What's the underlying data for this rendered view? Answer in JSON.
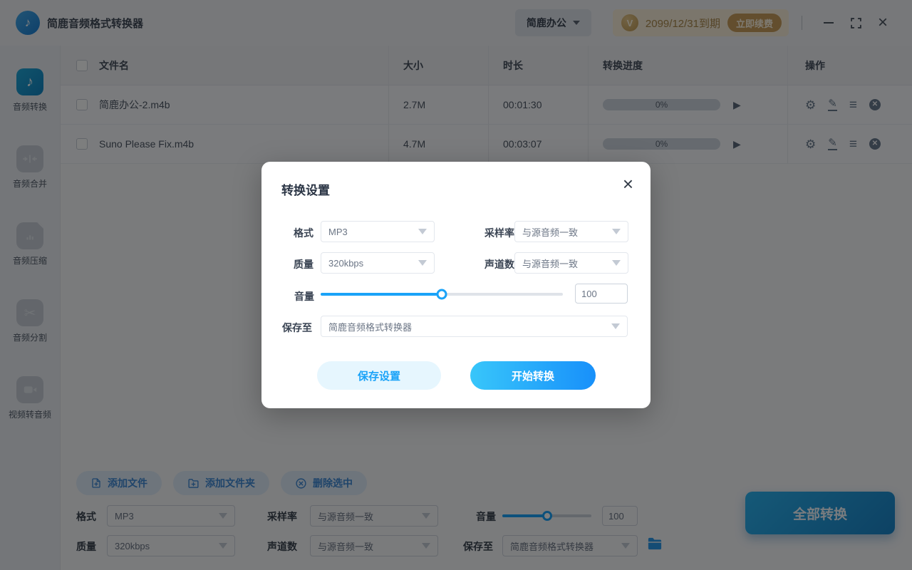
{
  "header": {
    "app_title": "简鹿音频格式转换器",
    "workspace_label": "简鹿办公",
    "license": {
      "vip_glyph": "V",
      "expiry_text": "2099/12/31到期",
      "renew_label": "立即续费"
    }
  },
  "icons": {
    "logo_note": "♪",
    "play": "▶",
    "gear": "⚙",
    "edit": "✎",
    "menu": "≡",
    "row_remove": "✕",
    "close": "×",
    "scissors": "✂",
    "music_note": "♪"
  },
  "sidebar": {
    "items": [
      {
        "label": "音频转换",
        "icon": "music-note",
        "active": true
      },
      {
        "label": "音频合并",
        "icon": "merge-arrows"
      },
      {
        "label": "音频压缩",
        "icon": "compress-file"
      },
      {
        "label": "音频分割",
        "icon": "scissors"
      },
      {
        "label": "视频转音频",
        "icon": "video-camera"
      }
    ]
  },
  "table": {
    "headers": [
      "文件名",
      "大小",
      "时长",
      "转换进度",
      "操作"
    ],
    "rows": [
      {
        "name": "简鹿办公-2.m4b",
        "size": "2.7M",
        "duration": "00:01:30",
        "progress": "0%"
      },
      {
        "name": "Suno Please Fix.m4b",
        "size": "4.7M",
        "duration": "00:03:07",
        "progress": "0%"
      }
    ]
  },
  "toolbar": {
    "add_file": "添加文件",
    "add_folder": "添加文件夹",
    "delete_selected": "删除选中"
  },
  "settings": {
    "format": {
      "label": "格式",
      "value": "MP3"
    },
    "sample_rate": {
      "label": "采样率",
      "value": "与源音频一致"
    },
    "quality": {
      "label": "质量",
      "value": "320kbps"
    },
    "channels": {
      "label": "声道数",
      "value": "与源音频一致"
    },
    "volume": {
      "label": "音量",
      "value": "100",
      "percent": 50
    },
    "save_to": {
      "label": "保存至",
      "value": "简鹿音频格式转换器"
    }
  },
  "modal": {
    "title": "转换设置",
    "fields": {
      "format": {
        "label": "格式",
        "value": "MP3"
      },
      "sample_rate": {
        "label": "采样率",
        "value": "与源音频一致"
      },
      "quality": {
        "label": "质量",
        "value": "320kbps"
      },
      "channels": {
        "label": "声道数",
        "value": "与源音频一致"
      },
      "volume": {
        "label": "音量",
        "value": "100",
        "percent": 50
      },
      "save_to": {
        "label": "保存至",
        "value": "简鹿音频格式转换器"
      }
    },
    "buttons": {
      "save": "保存设置",
      "start": "开始转换"
    }
  },
  "footer": {
    "convert_all": "全部转换"
  },
  "colors": {
    "accent": "#1aa3f8",
    "gold": "#c79d5c",
    "active_icon": "#1795c8"
  }
}
